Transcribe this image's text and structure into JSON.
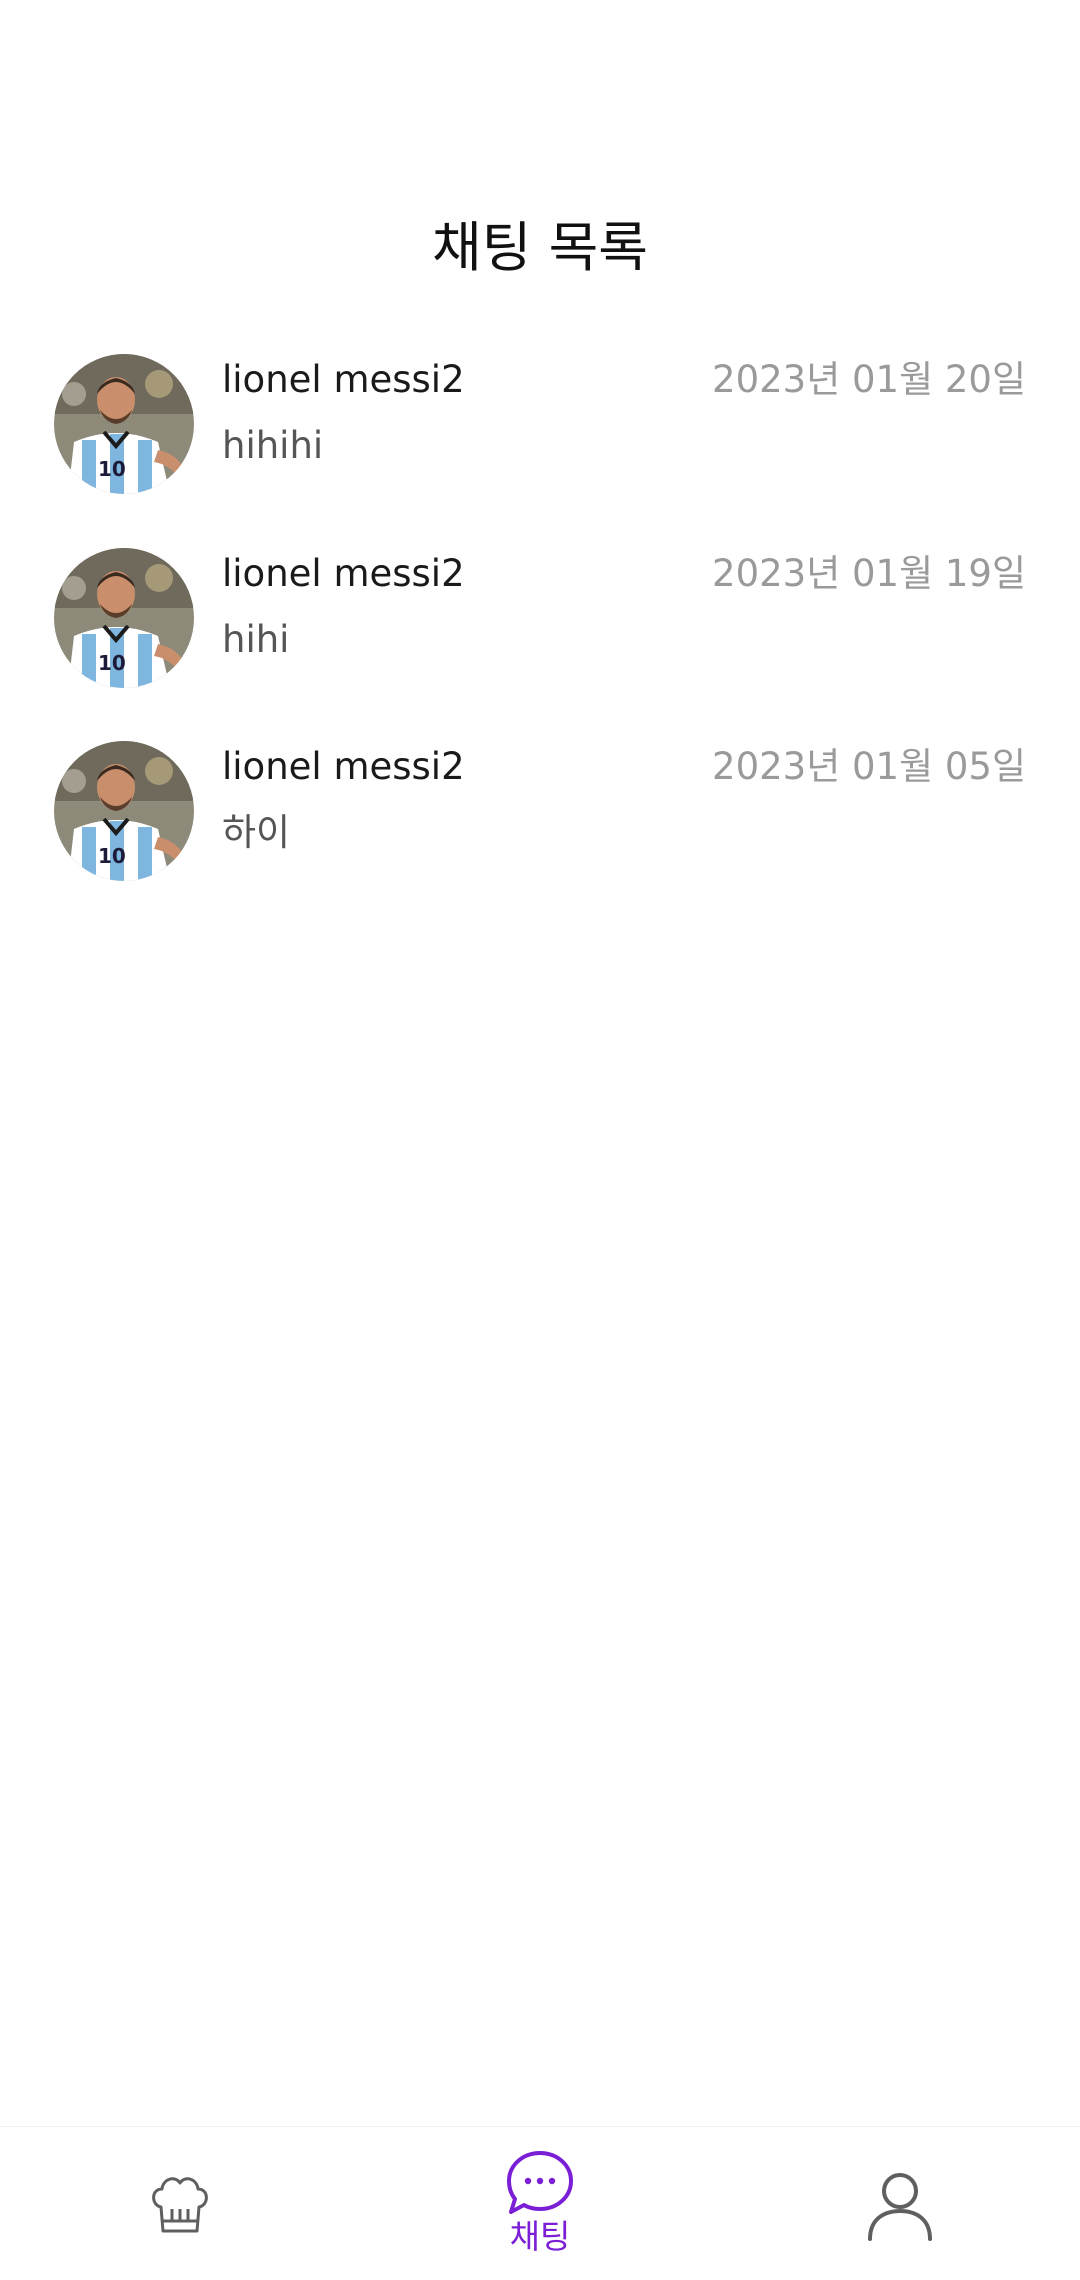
{
  "header": {
    "title": "채팅 목록"
  },
  "chats": [
    {
      "name": "lionel messi2",
      "date": "2023년 01월 20일",
      "last_message": "hihihi",
      "avatar": "profile-photo"
    },
    {
      "name": "lionel messi2",
      "date": "2023년 01월 19일",
      "last_message": "hihi",
      "avatar": "profile-photo"
    },
    {
      "name": "lionel messi2",
      "date": "2023년 01월 05일",
      "last_message": "하이",
      "avatar": "profile-photo"
    }
  ],
  "bottom_nav": {
    "items": [
      {
        "icon": "chef-hat-icon",
        "label": "",
        "active": false
      },
      {
        "icon": "chat-bubble-icon",
        "label": "채팅",
        "active": true
      },
      {
        "icon": "person-icon",
        "label": "",
        "active": false
      }
    ],
    "active_color": "#7b1fd6",
    "inactive_color": "#5f5f5f"
  }
}
